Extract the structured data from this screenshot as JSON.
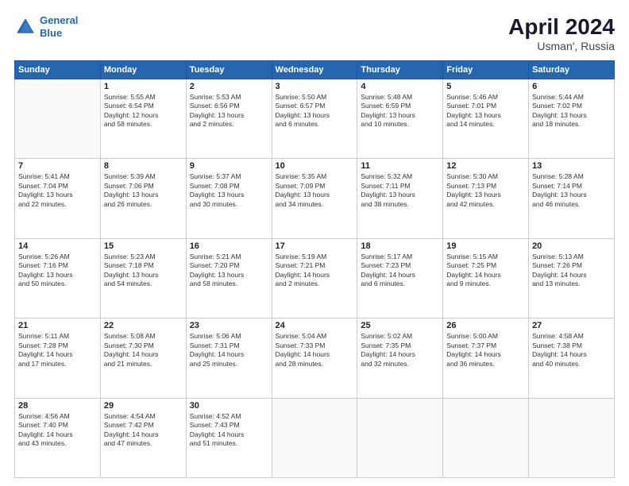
{
  "header": {
    "logo_line1": "General",
    "logo_line2": "Blue",
    "title": "April 2024",
    "subtitle": "Usman', Russia"
  },
  "weekdays": [
    "Sunday",
    "Monday",
    "Tuesday",
    "Wednesday",
    "Thursday",
    "Friday",
    "Saturday"
  ],
  "weeks": [
    [
      {
        "day": "",
        "info": ""
      },
      {
        "day": "1",
        "info": "Sunrise: 5:55 AM\nSunset: 6:54 PM\nDaylight: 12 hours\nand 58 minutes."
      },
      {
        "day": "2",
        "info": "Sunrise: 5:53 AM\nSunset: 6:56 PM\nDaylight: 13 hours\nand 2 minutes."
      },
      {
        "day": "3",
        "info": "Sunrise: 5:50 AM\nSunset: 6:57 PM\nDaylight: 13 hours\nand 6 minutes."
      },
      {
        "day": "4",
        "info": "Sunrise: 5:48 AM\nSunset: 6:59 PM\nDaylight: 13 hours\nand 10 minutes."
      },
      {
        "day": "5",
        "info": "Sunrise: 5:46 AM\nSunset: 7:01 PM\nDaylight: 13 hours\nand 14 minutes."
      },
      {
        "day": "6",
        "info": "Sunrise: 5:44 AM\nSunset: 7:02 PM\nDaylight: 13 hours\nand 18 minutes."
      }
    ],
    [
      {
        "day": "7",
        "info": "Sunrise: 5:41 AM\nSunset: 7:04 PM\nDaylight: 13 hours\nand 22 minutes."
      },
      {
        "day": "8",
        "info": "Sunrise: 5:39 AM\nSunset: 7:06 PM\nDaylight: 13 hours\nand 26 minutes."
      },
      {
        "day": "9",
        "info": "Sunrise: 5:37 AM\nSunset: 7:08 PM\nDaylight: 13 hours\nand 30 minutes."
      },
      {
        "day": "10",
        "info": "Sunrise: 5:35 AM\nSunset: 7:09 PM\nDaylight: 13 hours\nand 34 minutes."
      },
      {
        "day": "11",
        "info": "Sunrise: 5:32 AM\nSunset: 7:11 PM\nDaylight: 13 hours\nand 38 minutes."
      },
      {
        "day": "12",
        "info": "Sunrise: 5:30 AM\nSunset: 7:13 PM\nDaylight: 13 hours\nand 42 minutes."
      },
      {
        "day": "13",
        "info": "Sunrise: 5:28 AM\nSunset: 7:14 PM\nDaylight: 13 hours\nand 46 minutes."
      }
    ],
    [
      {
        "day": "14",
        "info": "Sunrise: 5:26 AM\nSunset: 7:16 PM\nDaylight: 13 hours\nand 50 minutes."
      },
      {
        "day": "15",
        "info": "Sunrise: 5:23 AM\nSunset: 7:18 PM\nDaylight: 13 hours\nand 54 minutes."
      },
      {
        "day": "16",
        "info": "Sunrise: 5:21 AM\nSunset: 7:20 PM\nDaylight: 13 hours\nand 58 minutes."
      },
      {
        "day": "17",
        "info": "Sunrise: 5:19 AM\nSunset: 7:21 PM\nDaylight: 14 hours\nand 2 minutes."
      },
      {
        "day": "18",
        "info": "Sunrise: 5:17 AM\nSunset: 7:23 PM\nDaylight: 14 hours\nand 6 minutes."
      },
      {
        "day": "19",
        "info": "Sunrise: 5:15 AM\nSunset: 7:25 PM\nDaylight: 14 hours\nand 9 minutes."
      },
      {
        "day": "20",
        "info": "Sunrise: 5:13 AM\nSunset: 7:26 PM\nDaylight: 14 hours\nand 13 minutes."
      }
    ],
    [
      {
        "day": "21",
        "info": "Sunrise: 5:11 AM\nSunset: 7:28 PM\nDaylight: 14 hours\nand 17 minutes."
      },
      {
        "day": "22",
        "info": "Sunrise: 5:08 AM\nSunset: 7:30 PM\nDaylight: 14 hours\nand 21 minutes."
      },
      {
        "day": "23",
        "info": "Sunrise: 5:06 AM\nSunset: 7:31 PM\nDaylight: 14 hours\nand 25 minutes."
      },
      {
        "day": "24",
        "info": "Sunrise: 5:04 AM\nSunset: 7:33 PM\nDaylight: 14 hours\nand 28 minutes."
      },
      {
        "day": "25",
        "info": "Sunrise: 5:02 AM\nSunset: 7:35 PM\nDaylight: 14 hours\nand 32 minutes."
      },
      {
        "day": "26",
        "info": "Sunrise: 5:00 AM\nSunset: 7:37 PM\nDaylight: 14 hours\nand 36 minutes."
      },
      {
        "day": "27",
        "info": "Sunrise: 4:58 AM\nSunset: 7:38 PM\nDaylight: 14 hours\nand 40 minutes."
      }
    ],
    [
      {
        "day": "28",
        "info": "Sunrise: 4:56 AM\nSunset: 7:40 PM\nDaylight: 14 hours\nand 43 minutes."
      },
      {
        "day": "29",
        "info": "Sunrise: 4:54 AM\nSunset: 7:42 PM\nDaylight: 14 hours\nand 47 minutes."
      },
      {
        "day": "30",
        "info": "Sunrise: 4:52 AM\nSunset: 7:43 PM\nDaylight: 14 hours\nand 51 minutes."
      },
      {
        "day": "",
        "info": ""
      },
      {
        "day": "",
        "info": ""
      },
      {
        "day": "",
        "info": ""
      },
      {
        "day": "",
        "info": ""
      }
    ]
  ]
}
